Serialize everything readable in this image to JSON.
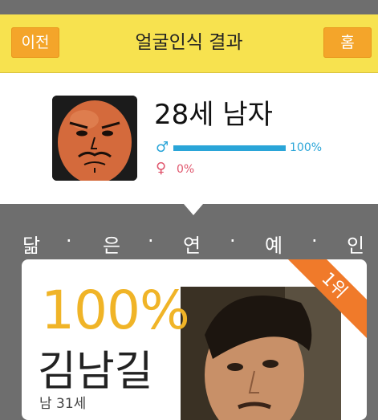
{
  "header": {
    "back_label": "이전",
    "title": "얼굴인식 결과",
    "home_label": "홈"
  },
  "result": {
    "age_gender": "28세 남자",
    "male_percent_label": "100%",
    "female_percent_label": "0%",
    "male_ratio": 1.0,
    "female_ratio": 0.0
  },
  "section": {
    "title_chars": [
      "닮",
      "·",
      "은",
      "·",
      "연",
      "·",
      "예",
      "·",
      "인"
    ]
  },
  "top_match": {
    "rank_label": "1위",
    "match_percent": "100%",
    "name": "김남길",
    "detail": "남 31세"
  },
  "colors": {
    "header_bg": "#f7e24f",
    "button_bg": "#f4a52a",
    "male": "#2aa5d8",
    "female": "#e0566d",
    "accent_gold": "#f0b427",
    "ribbon": "#f07a2a"
  },
  "icons": {
    "male": "♂",
    "female": "♀"
  }
}
